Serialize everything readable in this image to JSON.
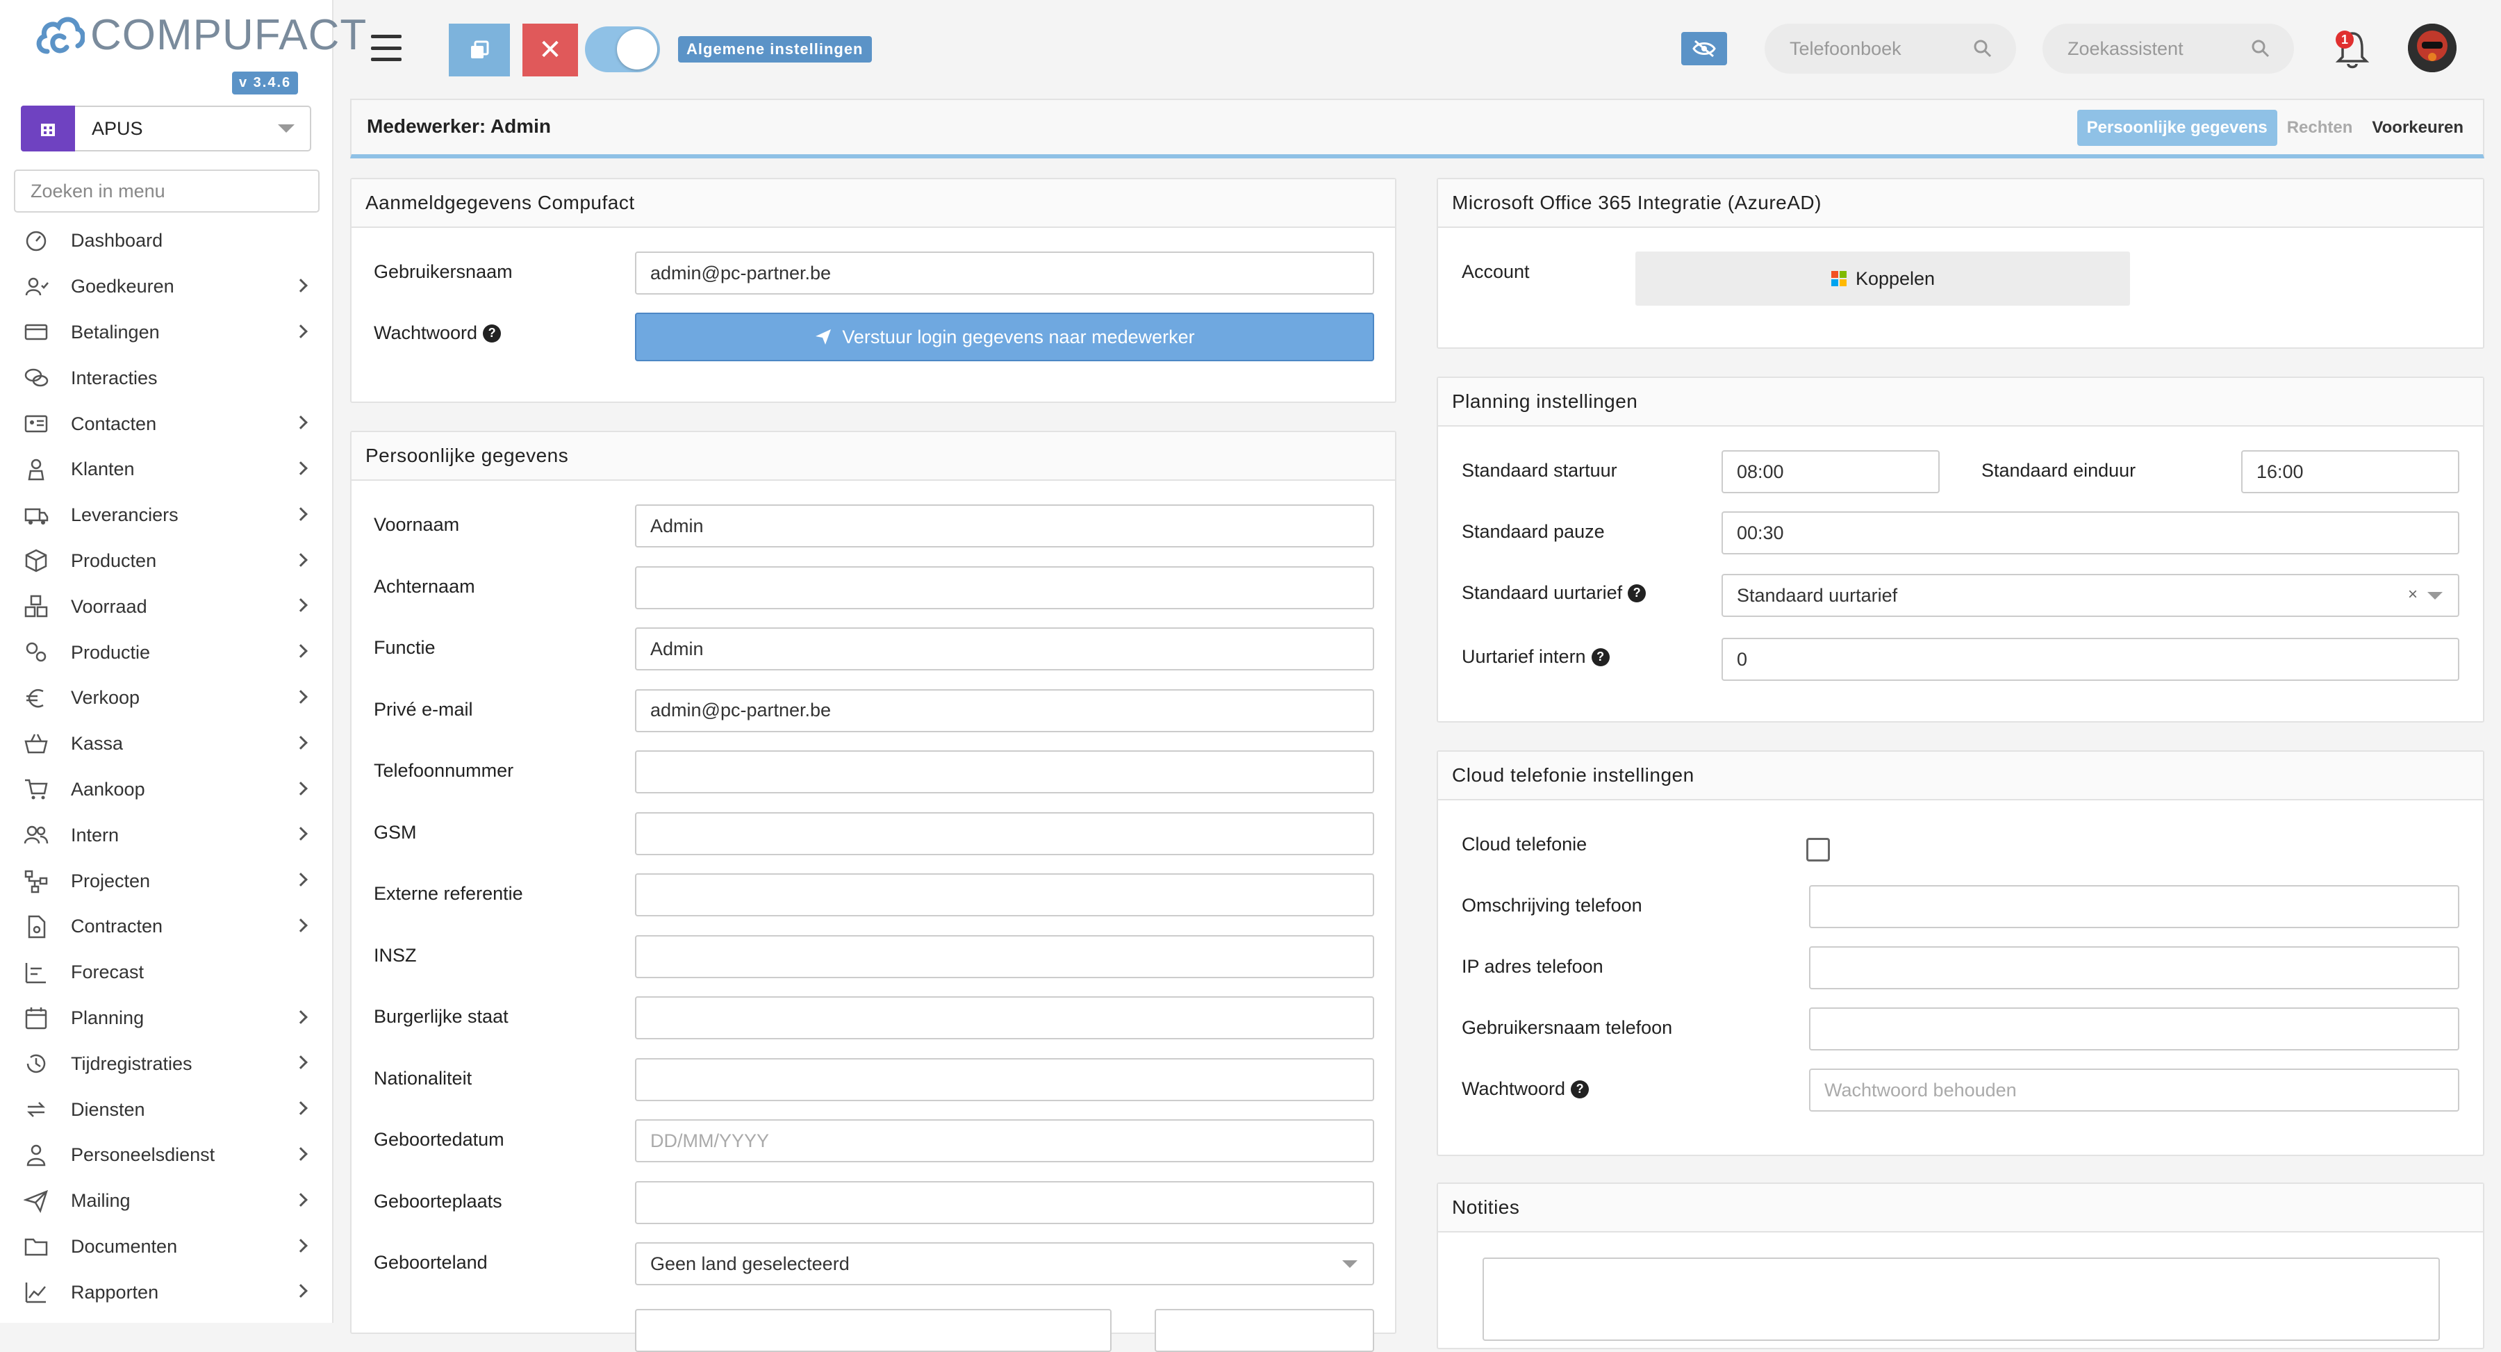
{
  "brand": {
    "name": "COMPUFACT",
    "version": "v 3.4.6",
    "accent": "#5b93c7"
  },
  "company_selector": {
    "value": "APUS",
    "icon": "building-icon"
  },
  "menu_search": {
    "placeholder": "Zoeken in menu"
  },
  "menu": [
    {
      "label": "Dashboard",
      "icon": "dashboard-icon",
      "has_children": false
    },
    {
      "label": "Goedkeuren",
      "icon": "user-check-icon",
      "has_children": true
    },
    {
      "label": "Betalingen",
      "icon": "payments-icon",
      "has_children": true
    },
    {
      "label": "Interacties",
      "icon": "chat-icon",
      "has_children": false
    },
    {
      "label": "Contacten",
      "icon": "contact-card-icon",
      "has_children": true
    },
    {
      "label": "Klanten",
      "icon": "customer-icon",
      "has_children": true
    },
    {
      "label": "Leveranciers",
      "icon": "truck-icon",
      "has_children": true
    },
    {
      "label": "Producten",
      "icon": "box-icon",
      "has_children": true
    },
    {
      "label": "Voorraad",
      "icon": "boxes-icon",
      "has_children": true
    },
    {
      "label": "Productie",
      "icon": "gears-icon",
      "has_children": true
    },
    {
      "label": "Verkoop",
      "icon": "euro-icon",
      "has_children": true
    },
    {
      "label": "Kassa",
      "icon": "basket-icon",
      "has_children": true
    },
    {
      "label": "Aankoop",
      "icon": "cart-icon",
      "has_children": true
    },
    {
      "label": "Intern",
      "icon": "users-icon",
      "has_children": true
    },
    {
      "label": "Projecten",
      "icon": "project-icon",
      "has_children": true
    },
    {
      "label": "Contracten",
      "icon": "contract-icon",
      "has_children": true
    },
    {
      "label": "Forecast",
      "icon": "forecast-icon",
      "has_children": false
    },
    {
      "label": "Planning",
      "icon": "calendar-icon",
      "has_children": true
    },
    {
      "label": "Tijdregistraties",
      "icon": "history-icon",
      "has_children": true
    },
    {
      "label": "Diensten",
      "icon": "refresh-icon",
      "has_children": true
    },
    {
      "label": "Personeelsdienst",
      "icon": "personnel-icon",
      "has_children": true
    },
    {
      "label": "Mailing",
      "icon": "paper-plane-icon",
      "has_children": true
    },
    {
      "label": "Documenten",
      "icon": "folder-icon",
      "has_children": true
    },
    {
      "label": "Rapporten",
      "icon": "chart-line-icon",
      "has_children": true
    }
  ],
  "topbar": {
    "settings_badge": "Algemene instellingen",
    "phonebook_placeholder": "Telefoonboek",
    "assistant_placeholder": "Zoekassistent",
    "notifications_count": "1"
  },
  "header": {
    "title": "Medewerker: Admin",
    "tabs": [
      "Persoonlijke gegevens",
      "Rechten",
      "Voorkeuren"
    ]
  },
  "login_panel": {
    "title": "Aanmeldgegevens Compufact",
    "username_label": "Gebruikersnaam",
    "username_value": "admin@pc-partner.be",
    "password_label": "Wachtwoord",
    "send_button": "Verstuur login gegevens naar medewerker"
  },
  "personal_panel": {
    "title": "Persoonlijke gegevens",
    "fields": [
      {
        "label": "Voornaam",
        "value": "Admin",
        "placeholder": ""
      },
      {
        "label": "Achternaam",
        "value": "",
        "placeholder": ""
      },
      {
        "label": "Functie",
        "value": "Admin",
        "placeholder": ""
      },
      {
        "label": "Privé e-mail",
        "value": "admin@pc-partner.be",
        "placeholder": ""
      },
      {
        "label": "Telefoonnummer",
        "value": "",
        "placeholder": ""
      },
      {
        "label": "GSM",
        "value": "",
        "placeholder": ""
      },
      {
        "label": "Externe referentie",
        "value": "",
        "placeholder": ""
      },
      {
        "label": "INSZ",
        "value": "",
        "placeholder": ""
      },
      {
        "label": "Burgerlijke staat",
        "value": "",
        "placeholder": ""
      },
      {
        "label": "Nationaliteit",
        "value": "",
        "placeholder": ""
      },
      {
        "label": "Geboortedatum",
        "value": "",
        "placeholder": "DD/MM/YYYY"
      },
      {
        "label": "Geboorteplaats",
        "value": "",
        "placeholder": ""
      },
      {
        "label": "Geboorteland",
        "value": "Geen land geselecteerd",
        "placeholder": ""
      }
    ]
  },
  "office_panel": {
    "title": "Microsoft Office 365 Integratie (AzureAD)",
    "account_label": "Account",
    "link_button": "Koppelen"
  },
  "planning_panel": {
    "title": "Planning instellingen",
    "start_label": "Standaard startuur",
    "start_value": "08:00",
    "end_label": "Standaard einduur",
    "end_value": "16:00",
    "pause_label": "Standaard pauze",
    "pause_value": "00:30",
    "rate_label": "Standaard uurtarief",
    "rate_value": "Standaard uurtarief",
    "internal_label": "Uurtarief intern",
    "internal_value": "0"
  },
  "cloud_panel": {
    "title": "Cloud telefonie instellingen",
    "cloud_label": "Cloud telefonie",
    "desc_label": "Omschrijving telefoon",
    "ip_label": "IP adres telefoon",
    "user_label": "Gebruikersnaam telefoon",
    "pw_label": "Wachtwoord",
    "pw_placeholder": "Wachtwoord behouden"
  },
  "notes_panel": {
    "title": "Notities"
  }
}
